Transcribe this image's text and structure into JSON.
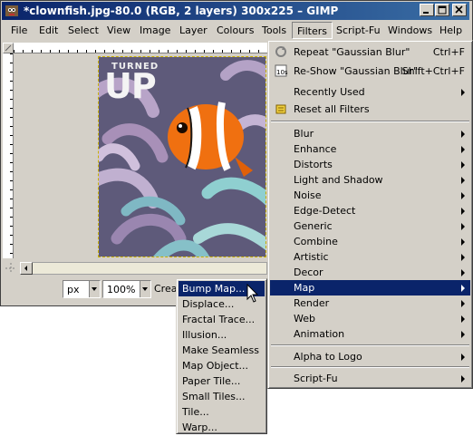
{
  "window": {
    "title": "*clownfish.jpg-80.0 (RGB, 2 layers) 300x225 – GIMP",
    "icon": "gimp-app-icon",
    "buttons": [
      "minimize-icon",
      "maximize-icon",
      "close-icon"
    ]
  },
  "menubar": {
    "items": [
      "File",
      "Edit",
      "Select",
      "View",
      "Image",
      "Layer",
      "Colours",
      "Tools",
      "Filters",
      "Script-Fu",
      "Windows",
      "Help"
    ],
    "selected": "Filters"
  },
  "image": {
    "overlay_text_small": "TURNED",
    "overlay_text_big": "UP"
  },
  "statusbar": {
    "unit": "px",
    "zoom": "100%",
    "status_text": "Crea"
  },
  "filters_menu": {
    "repeat_label": "Repeat \"Gaussian Blur\"",
    "repeat_shortcut": "Ctrl+F",
    "reshow_label": "Re-Show \"Gaussian Blur\"",
    "reshow_shortcut": "Shift+Ctrl+F",
    "recently_used": "Recently Used",
    "reset_all": "Reset all Filters",
    "submenus": [
      "Blur",
      "Enhance",
      "Distorts",
      "Light and Shadow",
      "Noise",
      "Edge-Detect",
      "Generic",
      "Combine",
      "Artistic",
      "Decor",
      "Map",
      "Render",
      "Web",
      "Animation"
    ],
    "highlighted": "Map",
    "alpha_to_logo": "Alpha to Logo",
    "script_fu": "Script-Fu"
  },
  "map_menu": {
    "items": [
      "Bump Map...",
      "Displace...",
      "Fractal Trace...",
      "Illusion...",
      "Make Seamless",
      "Map Object...",
      "Paper Tile...",
      "Small Tiles...",
      "Tile...",
      "Warp..."
    ],
    "highlighted": "Bump Map..."
  },
  "colors": {
    "titlebar": "#0a246a",
    "highlight": "#0a246a",
    "chrome": "#d4d0c8",
    "fish": "#f07010"
  }
}
